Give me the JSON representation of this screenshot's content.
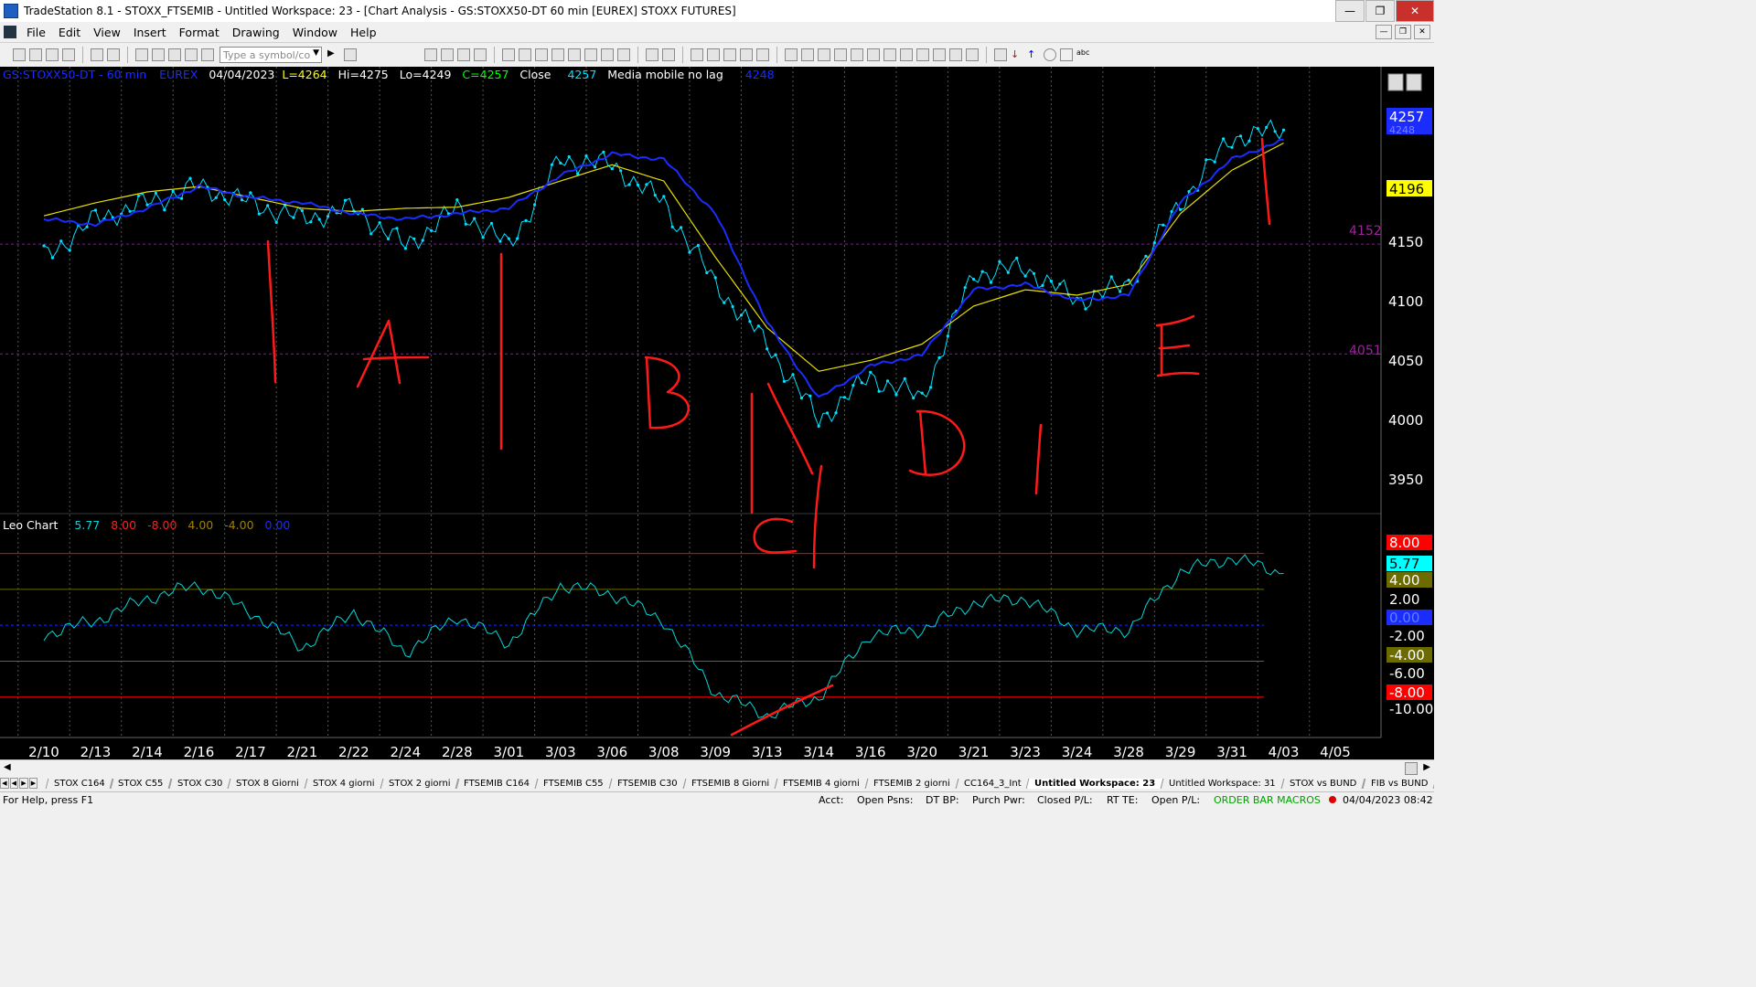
{
  "window": {
    "title": "TradeStation 8.1 - STOXX_FTSEMIB - Untitled Workspace:  23 - [Chart Analysis - GS:STOXX50-DT  60 min  [EUREX] STOXX FUTURES]"
  },
  "menu": [
    "File",
    "Edit",
    "View",
    "Insert",
    "Format",
    "Drawing",
    "Window",
    "Help"
  ],
  "toolbar": {
    "symbol_placeholder": "Type a symbol/co"
  },
  "chart": {
    "header": {
      "symbol": "GS:STOXX50-DT - 60 min",
      "exchange": "EUREX",
      "date": "04/04/2023",
      "last": "L=4264",
      "high": "Hi=4275",
      "low": "Lo=4249",
      "close": "C=4257",
      "close_label": "Close",
      "close_value": "4257",
      "indicator": "Media mobile no lag",
      "indicator_value": "4248"
    },
    "price_axis_labels": [
      "4150",
      "4100",
      "4050",
      "4000",
      "3950"
    ],
    "price_tags": {
      "last": "4257",
      "avg": "4248",
      "yellow": "4196"
    },
    "level_lines": [
      "4152",
      "4051"
    ],
    "annotations": [
      "A",
      "B",
      "C",
      "D",
      "E"
    ],
    "colors": {
      "price": "#00e0ff",
      "blue_avg": "#1b2cff",
      "yellow_avg": "#e8e000",
      "oscillator": "#00d8d8",
      "hand": "#ff1a1a"
    }
  },
  "oscillator": {
    "name": "Leo Chart",
    "values": [
      "5.77",
      "8.00",
      "-8.00",
      "4.00",
      "-4.00",
      "0.00"
    ],
    "axis_labels": [
      "2.00",
      "-2.00",
      "-6.00",
      "-10.00"
    ],
    "tags": [
      "8.00",
      "5.77",
      "4.00",
      "0.00",
      "-4.00",
      "-8.00"
    ]
  },
  "date_axis": [
    "2/10",
    "2/13",
    "2/14",
    "2/16",
    "2/17",
    "2/21",
    "2/22",
    "2/24",
    "2/28",
    "3/01",
    "3/03",
    "3/06",
    "3/08",
    "3/09",
    "3/13",
    "3/14",
    "3/16",
    "3/20",
    "3/21",
    "3/23",
    "3/24",
    "3/28",
    "3/29",
    "3/31",
    "4/03",
    "4/05"
  ],
  "workspace_tabs": [
    "STOX C164",
    "STOX C55",
    "STOX  C30",
    "STOX  8 Giorni",
    "STOX 4 giorni",
    "STOX  2 giorni",
    "FTSEMIB C164",
    "FTSEMIB C55",
    "FTSEMIB C30",
    "FTSEMIB  8 Giorni",
    "FTSEMIB  4 giorni",
    "FTSEMIB  2 giorni",
    "CC164_3_Int",
    "Untitled Workspace:  23",
    "Untitled Workspace:  31",
    "STOX vs BUND",
    "FIB vs BUND"
  ],
  "status": {
    "help": "For Help, press F1",
    "acct": "Acct:",
    "open_psns": "Open Psns:",
    "dt_bp": "DT BP:",
    "purch_pwr": "Purch Pwr:",
    "closed_pl": "Closed P/L:",
    "rt_te": "RT TE:",
    "open_pl": "Open P/L:",
    "macros": "ORDER BAR  MACROS",
    "datetime": "04/04/2023 08:42"
  },
  "chart_data": {
    "type": "line",
    "x": [
      "2/10",
      "2/13",
      "2/14",
      "2/16",
      "2/17",
      "2/21",
      "2/22",
      "2/24",
      "2/28",
      "3/01",
      "3/03",
      "3/06",
      "3/08",
      "3/09",
      "3/13",
      "3/14",
      "3/16",
      "3/20",
      "3/21",
      "3/23",
      "3/24",
      "3/28",
      "3/29",
      "3/31",
      "4/03"
    ],
    "series": [
      {
        "values": [
          4140,
          4175,
          4190,
          4205,
          4190,
          4175,
          4185,
          4150,
          4185,
          4150,
          4230,
          4225,
          4190,
          4115,
          4060,
          3990,
          4030,
          4010,
          4125,
          4130,
          4100,
          4115,
          4190,
          4250,
          4257
        ]
      },
      {
        "values": [
          4175,
          4170,
          4185,
          4205,
          4195,
          4190,
          4180,
          4175,
          4180,
          4185,
          4215,
          4235,
          4230,
          4180,
          4080,
          4010,
          4040,
          4050,
          4110,
          4115,
          4100,
          4105,
          4190,
          4230,
          4248
        ]
      },
      {
        "values": [
          4178,
          4190,
          4200,
          4205,
          4195,
          4185,
          4182,
          4185,
          4186,
          4195,
          4210,
          4225,
          4210,
          4140,
          4075,
          4035,
          4045,
          4060,
          4095,
          4110,
          4105,
          4115,
          4180,
          4220,
          4245
        ]
      }
    ],
    "ylim": [
      3920,
      4290
    ],
    "oscillator": {
      "name": "Leo Chart",
      "x": [
        "2/10",
        "2/13",
        "2/14",
        "2/16",
        "2/17",
        "2/21",
        "2/22",
        "2/24",
        "2/28",
        "3/01",
        "3/03",
        "3/06",
        "3/08",
        "3/09",
        "3/13",
        "3/14",
        "3/16",
        "3/20",
        "3/21",
        "3/23",
        "3/24",
        "3/28",
        "3/29",
        "3/31",
        "4/03"
      ],
      "values": [
        -1.0,
        0.5,
        3.0,
        4.5,
        1.5,
        -2.5,
        1.5,
        -3.0,
        1.0,
        -2.0,
        4.5,
        3.5,
        0.5,
        -7.5,
        -10.0,
        -8.0,
        -1.0,
        -0.5,
        2.5,
        3.0,
        -0.5,
        -0.5,
        6.0,
        7.5,
        5.77
      ],
      "ylim": [
        -12.5,
        10.5
      ],
      "levels": [
        8,
        4,
        0,
        -4,
        -8
      ]
    }
  }
}
